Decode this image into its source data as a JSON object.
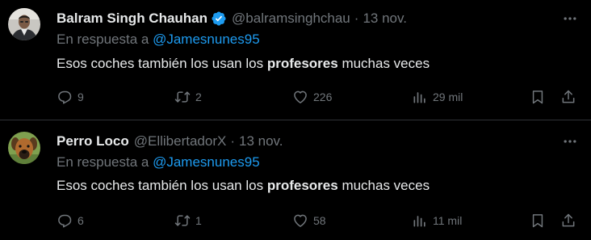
{
  "tweets": [
    {
      "name": "Balram Singh Chauhan",
      "verified": true,
      "handle": "@balramsinghchau",
      "dot": "·",
      "date": "13 nov.",
      "reply_prefix": "En respuesta a",
      "reply_mention": "@Jamesnunes95",
      "text_before": "Esos coches también los usan los",
      "text_bold": "profesores",
      "text_after": "muchas veces",
      "replies": "9",
      "retweets": "2",
      "likes": "226",
      "views": "29 mil"
    },
    {
      "name": "Perro Loco",
      "verified": false,
      "handle": "@EllibertadorX",
      "dot": "·",
      "date": "13 nov.",
      "reply_prefix": "En respuesta a",
      "reply_mention": "@Jamesnunes95",
      "text_before": "Esos coches también los usan los",
      "text_bold": "profesores",
      "text_after": "muchas veces",
      "replies": "6",
      "retweets": "1",
      "likes": "58",
      "views": "11 mil"
    }
  ],
  "icons": {
    "reply": "reply-icon",
    "retweet": "retweet-icon",
    "like": "heart-icon",
    "views": "views-icon",
    "bookmark": "bookmark-icon",
    "share": "share-icon",
    "more": "more-icon",
    "verified": "verified-badge-icon"
  },
  "colors": {
    "background": "#000000",
    "text": "#e7e9ea",
    "muted": "#71767b",
    "link": "#1d9bf0",
    "verified": "#1d9bf0",
    "divider": "#2f3336"
  }
}
